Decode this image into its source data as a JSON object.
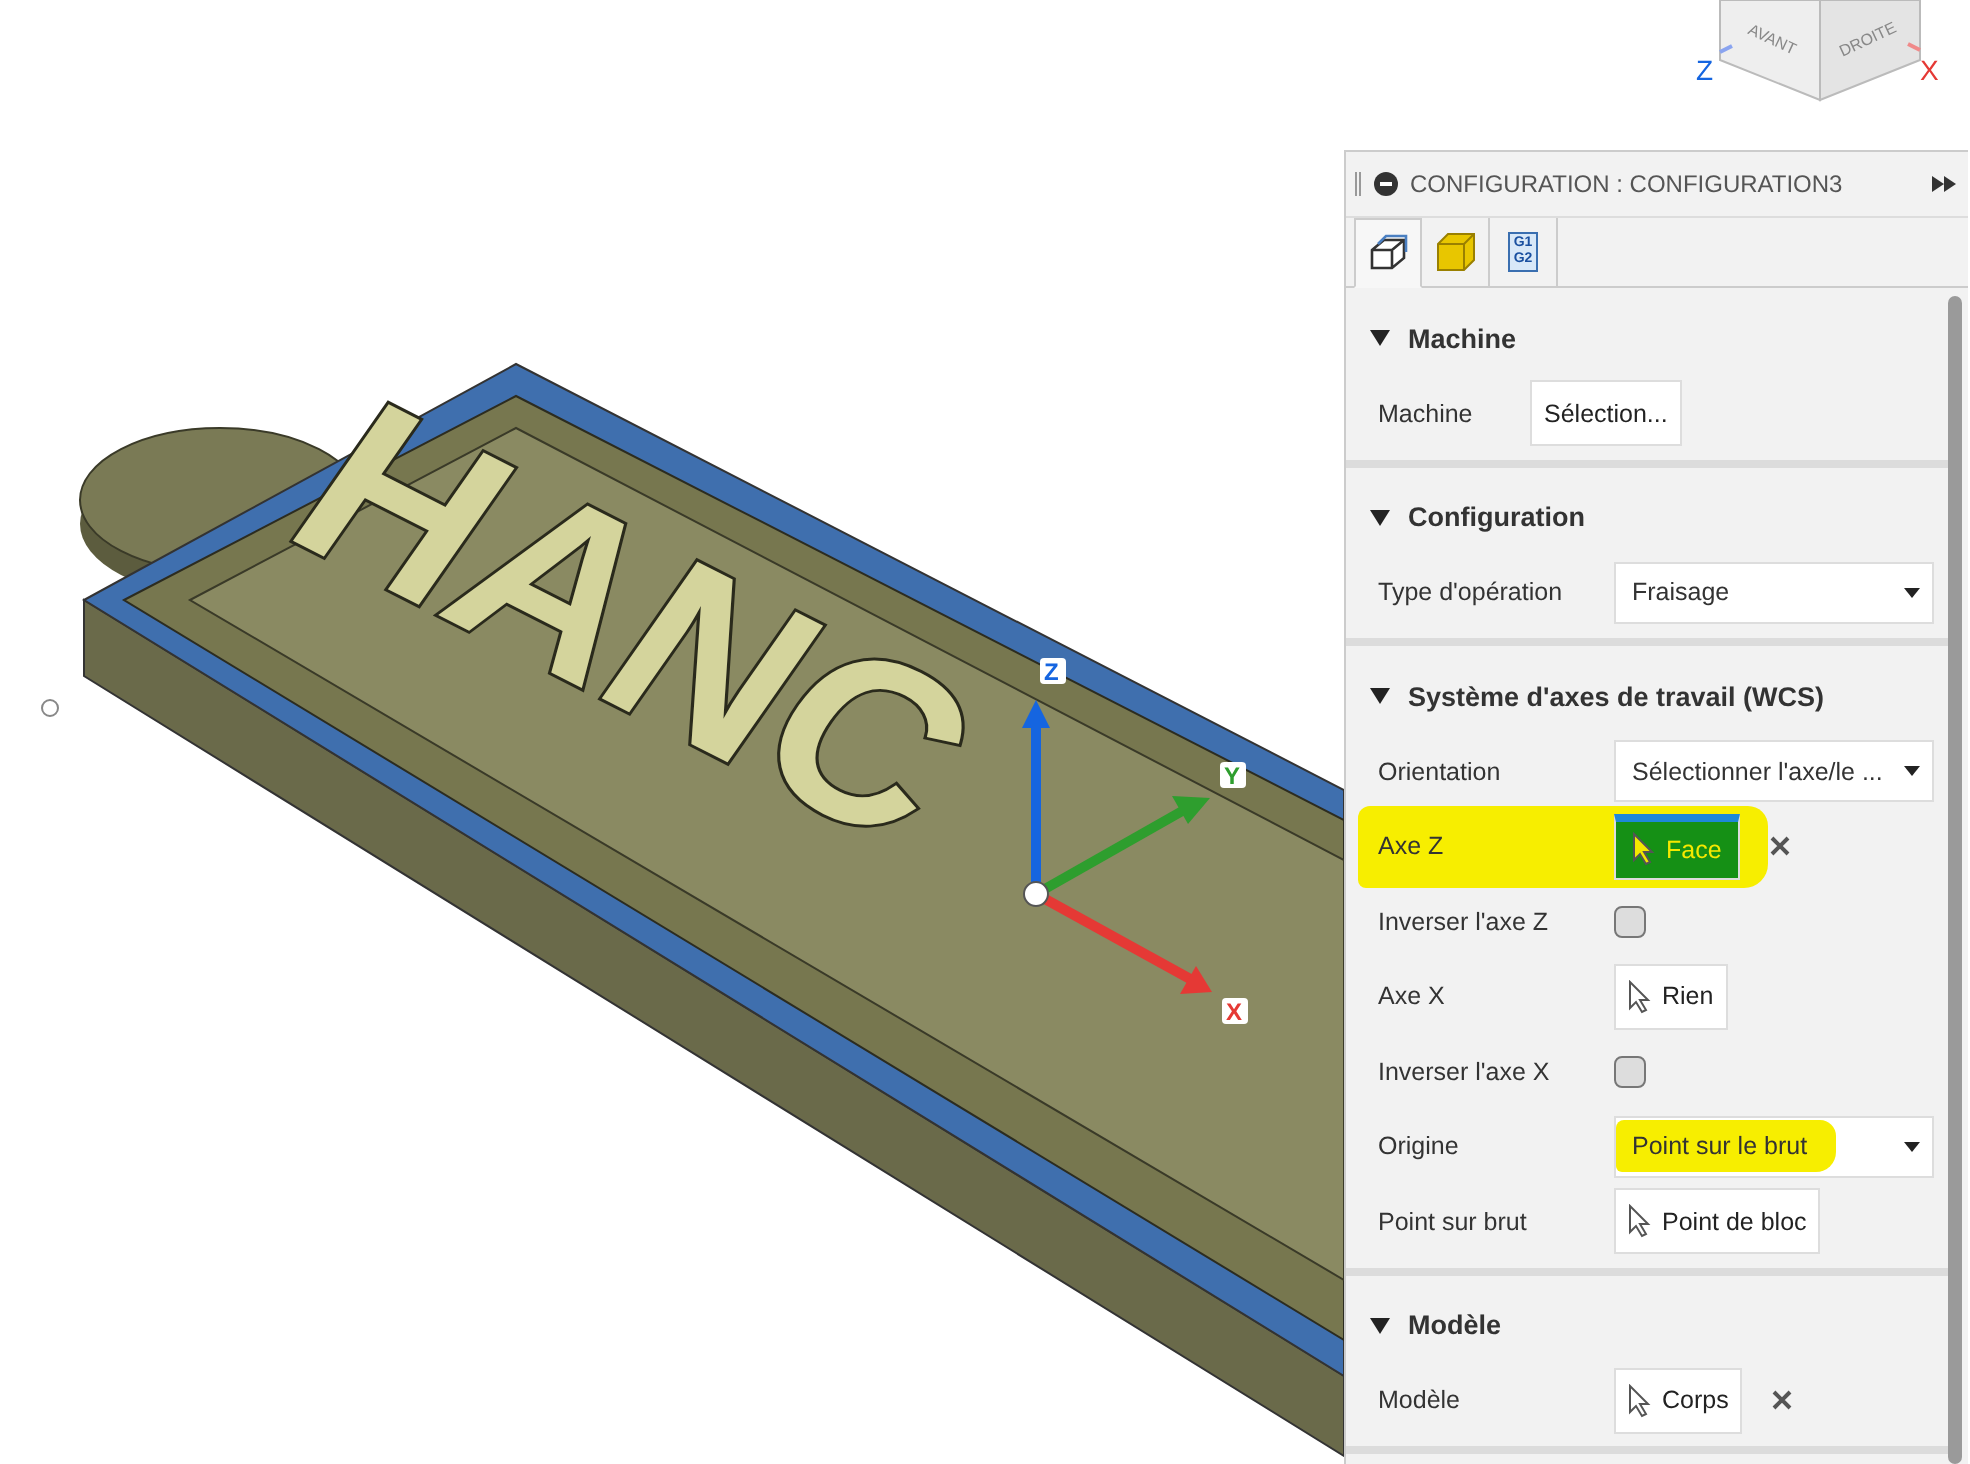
{
  "viewport": {
    "model_text": "HANC",
    "triad": [
      {
        "kind": "z",
        "label": "Z"
      },
      {
        "kind": "y",
        "label": "Y"
      },
      {
        "kind": "x",
        "label": "X"
      }
    ],
    "view_cube": {
      "faces": [
        "AVANT",
        "DROITE"
      ],
      "axes": [
        {
          "kind": "z",
          "label": "Z"
        },
        {
          "kind": "x",
          "label": "X"
        }
      ]
    }
  },
  "panel": {
    "title": "CONFIGURATION : CONFIGURATION3",
    "tabs": [
      {
        "kind": "setup",
        "selected": true
      },
      {
        "kind": "stock",
        "selected": false
      },
      {
        "kind": "post",
        "selected": false,
        "glyph": [
          "G1",
          "G2"
        ]
      }
    ],
    "sections": [
      {
        "title": "Machine",
        "expanded": true,
        "rows": [
          {
            "kind": "button",
            "label": "Machine",
            "value": "Sélection...",
            "highlighted": false
          }
        ]
      },
      {
        "title": "Configuration",
        "expanded": true,
        "rows": [
          {
            "kind": "dropdown",
            "label": "Type d'opération",
            "value": "Fraisage",
            "highlighted": false
          }
        ]
      },
      {
        "title": "Système d'axes de travail (WCS)",
        "expanded": true,
        "rows": [
          {
            "kind": "dropdown",
            "label": "Orientation",
            "value": "Sélectionner l'axe/le ...",
            "highlighted": false
          },
          {
            "kind": "pick",
            "label": "Axe Z",
            "value": "Face",
            "active": true,
            "clearable": true,
            "highlighted": true
          },
          {
            "kind": "checkbox",
            "label": "Inverser l'axe Z",
            "checked": false,
            "highlighted": false
          },
          {
            "kind": "pick",
            "label": "Axe X",
            "value": "Rien",
            "active": false,
            "clearable": false,
            "highlighted": false
          },
          {
            "kind": "checkbox",
            "label": "Inverser l'axe X",
            "checked": false,
            "highlighted": false
          },
          {
            "kind": "dropdown",
            "label": "Origine",
            "value": "Point sur le brut",
            "highlighted": false,
            "value_highlighted": true
          },
          {
            "kind": "pick",
            "label": "Point sur brut",
            "value": "Point de bloc",
            "active": false,
            "clearable": false,
            "highlighted": false
          }
        ]
      },
      {
        "title": "Modèle",
        "expanded": true,
        "rows": [
          {
            "kind": "pick",
            "label": "Modèle",
            "value": "Corps",
            "active": false,
            "clearable": true,
            "highlighted": false
          }
        ]
      }
    ]
  }
}
